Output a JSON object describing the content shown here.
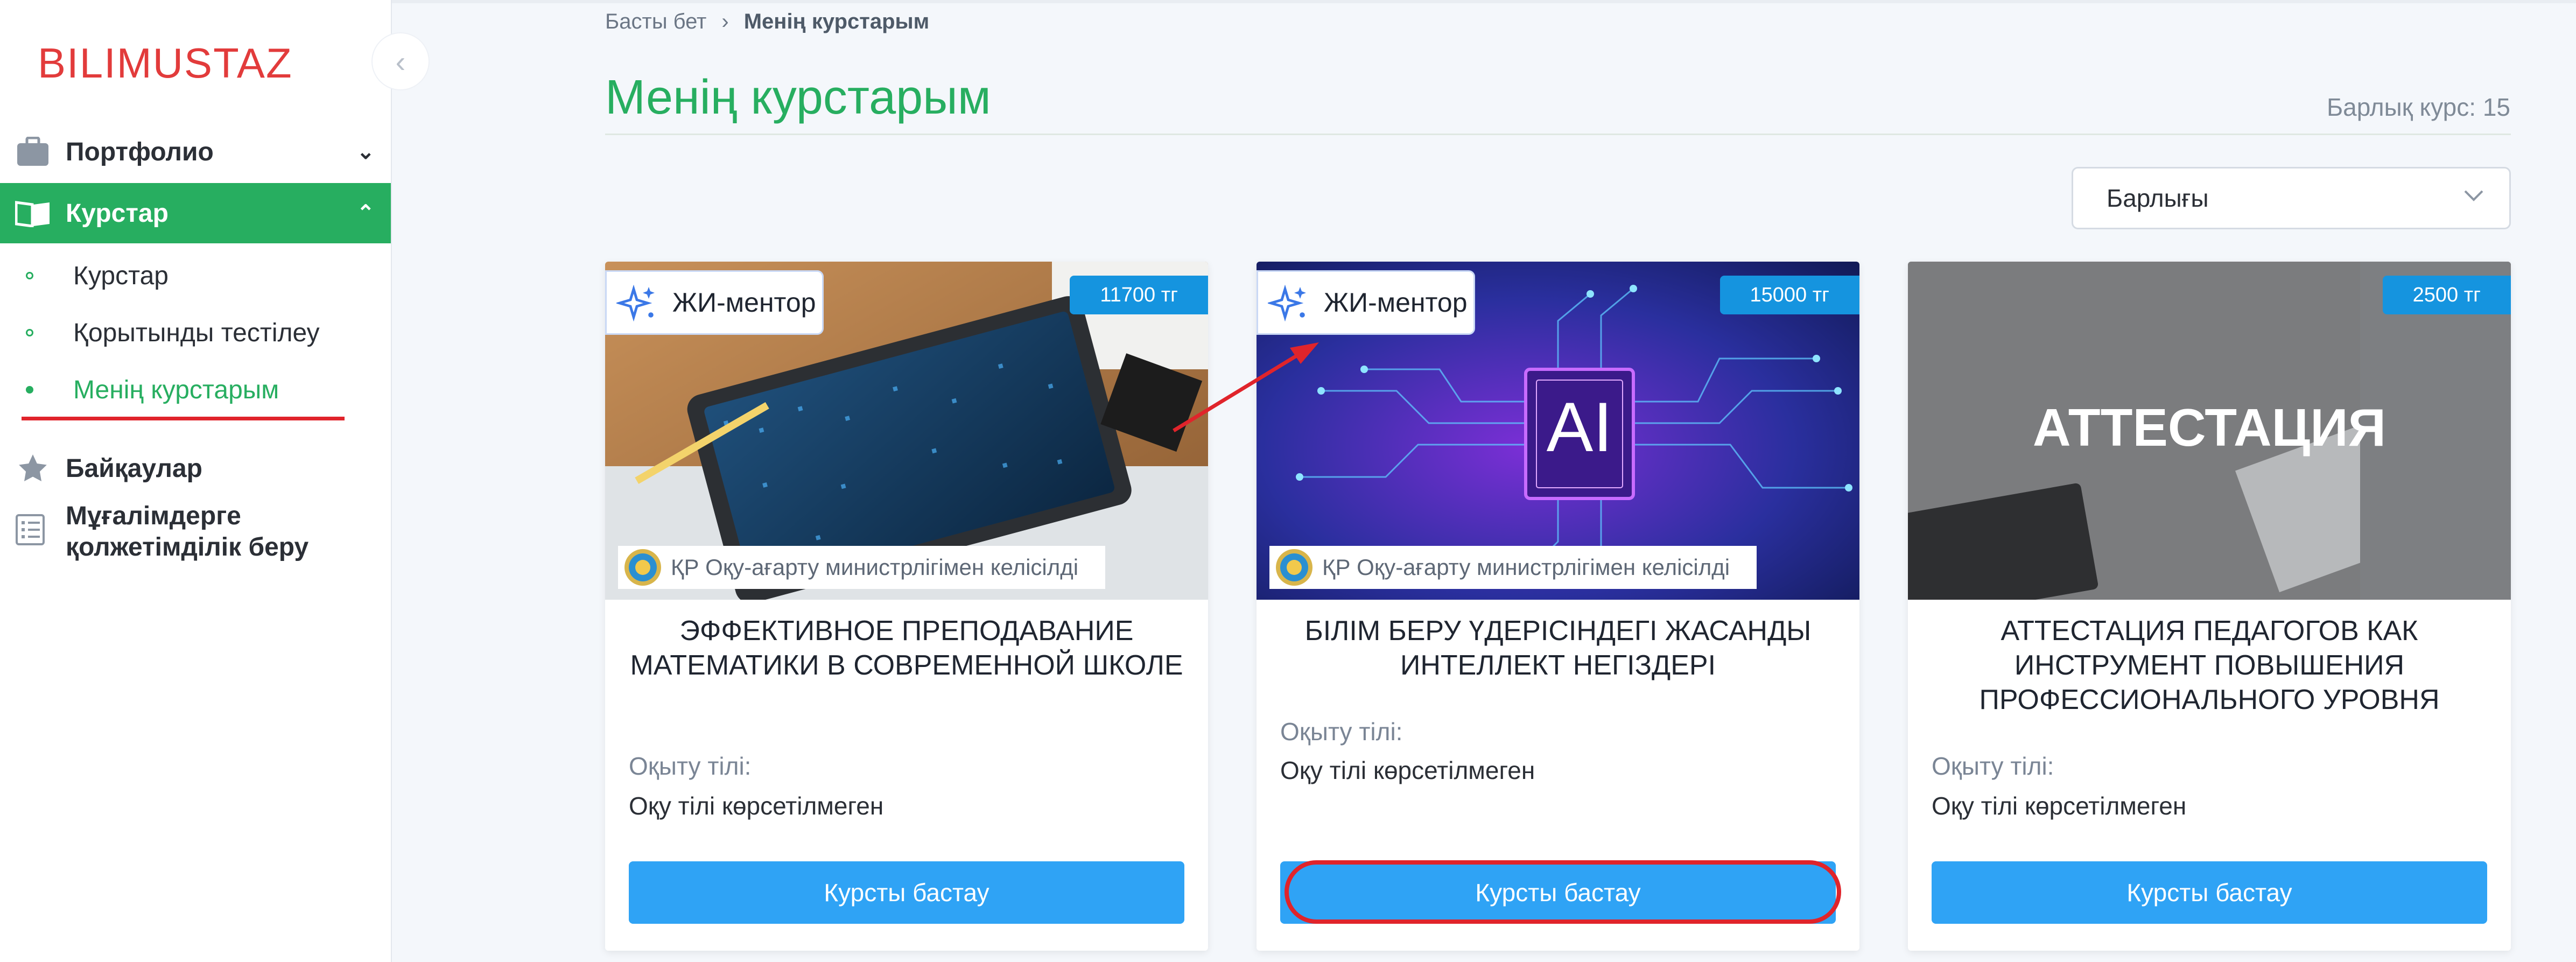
{
  "brand": {
    "logo": "BILIMUSTAZ"
  },
  "sidebar": {
    "items": [
      {
        "label": "Портфолио",
        "icon": "briefcase-icon"
      },
      {
        "label": "Курстар",
        "icon": "book-icon"
      },
      {
        "label": "Байқаулар",
        "icon": "star-icon"
      },
      {
        "label": "Мұғалімдерге қолжетімділік беру",
        "icon": "list-icon"
      }
    ],
    "subitems": [
      {
        "label": "Курстар"
      },
      {
        "label": "Қорытынды тестілеу"
      },
      {
        "label": "Менің курстарым"
      }
    ]
  },
  "breadcrumb": {
    "home": "Басты бет",
    "current": "Менің курстарым"
  },
  "page": {
    "title": "Менің курстарым",
    "total": "Барлық курс: 15",
    "filter": "Барлығы"
  },
  "cards": [
    {
      "price": "11700 тг",
      "mentor": "ЖИ-ментор",
      "ministry": "ҚР Оқу-ағарту министрлігімен келісілді",
      "title": "ЭФФЕКТИВНОЕ ПРЕПОДАВАНИЕ МАТЕМАТИКИ В СОВРЕМЕННОЙ ШКОЛЕ",
      "lang_label": "Оқыту тілі:",
      "lang_value": "Оқу тілі көрсетілмеген",
      "button": "Курсты бастау"
    },
    {
      "price": "15000 тг",
      "mentor": "ЖИ-ментор",
      "ministry": "ҚР Оқу-ағарту министрлігімен келісілді",
      "title": "БІЛІМ БЕРУ ҮДЕРІСІНДЕГІ ЖАСАНДЫ ИНТЕЛЛЕКТ НЕГІЗДЕРІ",
      "image_text": "AI",
      "lang_label": "Оқыту тілі:",
      "lang_value": "Оқу тілі көрсетілмеген",
      "button": "Курсты бастау"
    },
    {
      "price": "2500 тг",
      "title": "АТТЕСТАЦИЯ ПЕДАГОГОВ КАК ИНСТРУМЕНТ ПОВЫШЕНИЯ ПРОФЕССИОНАЛЬНОГО УРОВНЯ",
      "image_text": "АТТЕСТАЦИЯ",
      "lang_label": "Оқыту тілі:",
      "lang_value": "Оқу тілі көрсетілмеген",
      "button": "Курсты бастау"
    }
  ],
  "colors": {
    "accent": "#27ae60",
    "logo": "#e23b3b",
    "button": "#2fa3f5",
    "price_badge": "#1594df",
    "annotation": "#e0242b"
  }
}
